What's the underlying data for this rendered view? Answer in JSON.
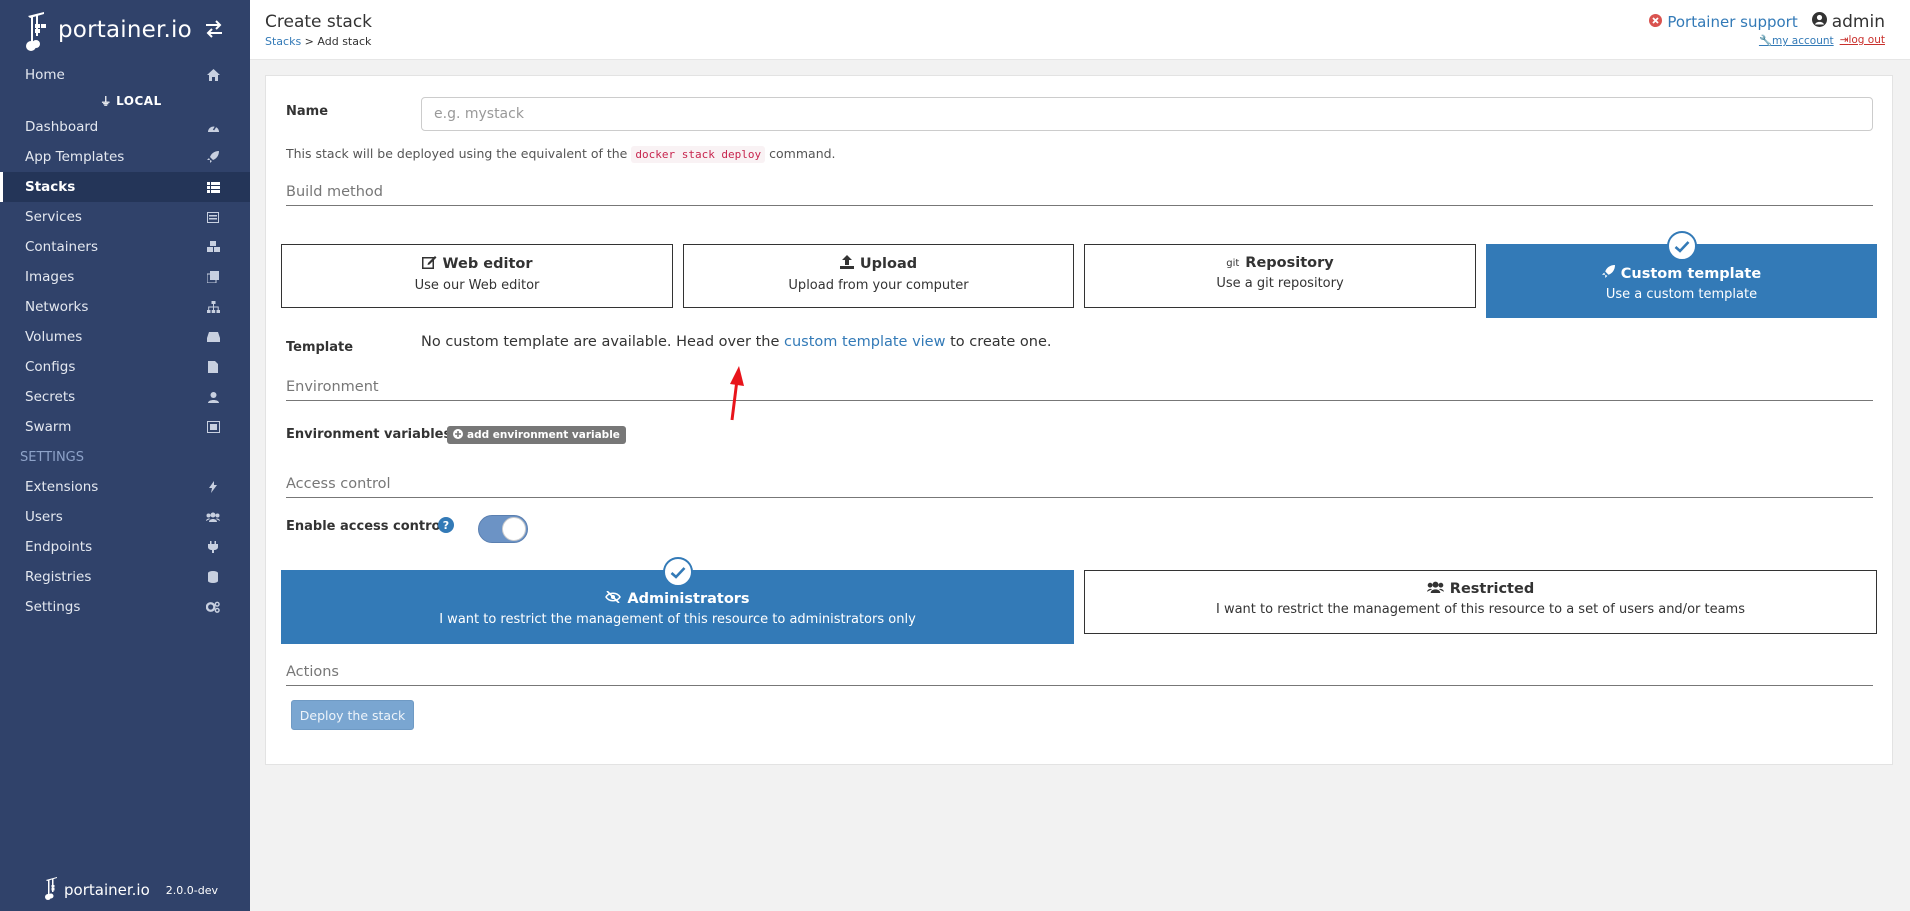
{
  "brand": {
    "name": "portainer.io"
  },
  "sidebar": {
    "home": "Home",
    "endpoint_header": "LOCAL",
    "items": [
      {
        "label": "Dashboard",
        "icon": "dashboard-icon"
      },
      {
        "label": "App Templates",
        "icon": "rocket-icon"
      },
      {
        "label": "Stacks",
        "icon": "list-icon",
        "active": true
      },
      {
        "label": "Services",
        "icon": "services-icon"
      },
      {
        "label": "Containers",
        "icon": "cubes-icon"
      },
      {
        "label": "Images",
        "icon": "clone-icon"
      },
      {
        "label": "Networks",
        "icon": "sitemap-icon"
      },
      {
        "label": "Volumes",
        "icon": "hdd-icon"
      },
      {
        "label": "Configs",
        "icon": "file-code-icon"
      },
      {
        "label": "Secrets",
        "icon": "user-secret-icon"
      },
      {
        "label": "Swarm",
        "icon": "object-group-icon"
      }
    ],
    "settings_header": "SETTINGS",
    "settings_items": [
      {
        "label": "Extensions",
        "icon": "bolt-icon"
      },
      {
        "label": "Users",
        "icon": "users-icon"
      },
      {
        "label": "Endpoints",
        "icon": "plug-icon"
      },
      {
        "label": "Registries",
        "icon": "database-icon"
      },
      {
        "label": "Settings",
        "icon": "cogs-icon"
      }
    ],
    "footer": {
      "logo_text": "portainer.io",
      "version": "2.0.0-dev"
    }
  },
  "header": {
    "title": "Create stack",
    "breadcrumb_link": "Stacks",
    "breadcrumb_sep": " > ",
    "breadcrumb_current": "Add stack",
    "support": "Portainer support",
    "user": "admin",
    "my_account": "my account",
    "log_out": "log out"
  },
  "form": {
    "name_label": "Name",
    "name_placeholder": "e.g. mystack",
    "help_prefix": "This stack will be deployed using the equivalent of the ",
    "help_code": "docker stack deploy",
    "help_suffix": " command.",
    "build_method_title": "Build method",
    "build_methods": [
      {
        "title": "Web editor",
        "desc": "Use our Web editor",
        "icon": "edit-icon"
      },
      {
        "title": "Upload",
        "desc": "Upload from your computer",
        "icon": "upload-icon"
      },
      {
        "title": "Repository",
        "desc": "Use a git repository",
        "icon": "git-icon",
        "icon_text": "git"
      },
      {
        "title": "Custom template",
        "desc": "Use a custom template",
        "icon": "rocket-icon",
        "selected": true
      }
    ],
    "template_label": "Template",
    "template_msg_prefix": "No custom template are available. Head over the ",
    "template_msg_link": "custom template view",
    "template_msg_suffix": " to create one.",
    "environment_title": "Environment",
    "env_vars_label": "Environment variables",
    "add_env_var": "add environment variable",
    "access_control_title": "Access control",
    "enable_access_control": "Enable access control",
    "access_control_enabled": true,
    "access_options": [
      {
        "title": "Administrators",
        "desc": "I want to restrict the management of this resource to administrators only",
        "icon": "eye-slash-icon",
        "selected": true
      },
      {
        "title": "Restricted",
        "desc": "I want to restrict the management of this resource to a set of users and/or teams",
        "icon": "users-icon"
      }
    ],
    "actions_title": "Actions",
    "deploy_button": "Deploy the stack"
  },
  "colors": {
    "sidebar": "#30426a",
    "primary": "#337ab7",
    "annotation_arrow": "#e8141b"
  }
}
